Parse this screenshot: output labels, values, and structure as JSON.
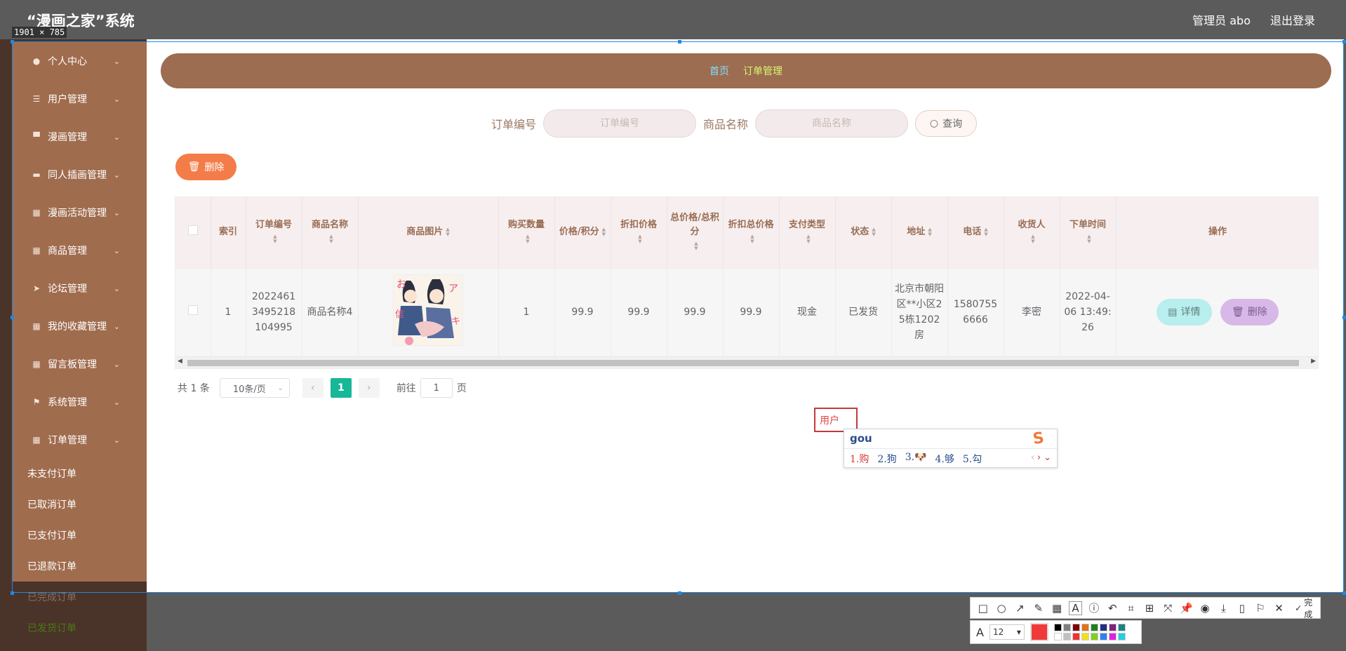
{
  "app": {
    "title": "“漫画之家”系统",
    "user": "管理员 abo",
    "logout": "退出登录",
    "capture_size": "1901 × 785"
  },
  "sidebar": {
    "items": [
      {
        "label": "个人中心",
        "icon": "user-icon"
      },
      {
        "label": "用户管理",
        "icon": "sliders-icon"
      },
      {
        "label": "漫画管理",
        "icon": "brush-icon"
      },
      {
        "label": "同人插画管理",
        "icon": "briefcase-icon"
      },
      {
        "label": "漫画活动管理",
        "icon": "grid-icon"
      },
      {
        "label": "商品管理",
        "icon": "apps-icon"
      },
      {
        "label": "论坛管理",
        "icon": "send-icon"
      },
      {
        "label": "我的收藏管理",
        "icon": "grid-icon"
      },
      {
        "label": "留言板管理",
        "icon": "grid-icon"
      },
      {
        "label": "系统管理",
        "icon": "flag-icon"
      },
      {
        "label": "订单管理",
        "icon": "grid-icon"
      }
    ],
    "sub_items": [
      "未支付订单",
      "已取消订单",
      "已支付订单",
      "已退款订单"
    ],
    "dim_items": [
      "已完成订单",
      "已发货订单"
    ]
  },
  "breadcrumb": {
    "home": "首页",
    "current": "订单管理",
    "separator": ""
  },
  "search": {
    "order_label": "订单编号",
    "order_placeholder": "订单编号",
    "goods_label": "商品名称",
    "goods_placeholder": "商品名称",
    "button": "查询"
  },
  "actions": {
    "delete": "删除"
  },
  "table": {
    "headers": [
      "索引",
      "订单编号",
      "商品名称",
      "商品图片",
      "购买数量",
      "价格/积分",
      "折扣价格",
      "总价格/总积分",
      "折扣总价格",
      "支付类型",
      "状态",
      "地址",
      "电话",
      "收货人",
      "下单时间",
      "操作"
    ],
    "rows": [
      {
        "index": "1",
        "order_no": "2022461 3495218 104995",
        "goods_name": "商品名称4",
        "quantity": "1",
        "price": "99.9",
        "discount_price": "99.9",
        "total": "99.9",
        "discount_total": "99.9",
        "pay_type": "现金",
        "status": "已发货",
        "address": "北京市朝阳区**小区25栋1202房",
        "phone": "15807556666",
        "receiver": "李密",
        "order_time": "2022-04-06 13:49:26",
        "detail_label": "详情",
        "delete_label": "删除"
      }
    ]
  },
  "pagination": {
    "total": "共 1 条",
    "page_size": "10条/页",
    "current": "1",
    "goto": "前往",
    "goto_value": "1",
    "page_unit": "页"
  },
  "annotation": {
    "text": "用户"
  },
  "ime": {
    "input": "gou",
    "candidates": [
      "1.购",
      "2.狗",
      "3.🐶",
      "4.够",
      "5.勾"
    ]
  },
  "screenshot_toolbar": {
    "done": "完成",
    "font_size": "12",
    "current_color": "#f03a3a"
  },
  "colors": {
    "sidebar": "#a06c4e",
    "breadcrumb": "#9c6d51",
    "delete_button": "#f47c48",
    "page_active": "#17b797"
  }
}
